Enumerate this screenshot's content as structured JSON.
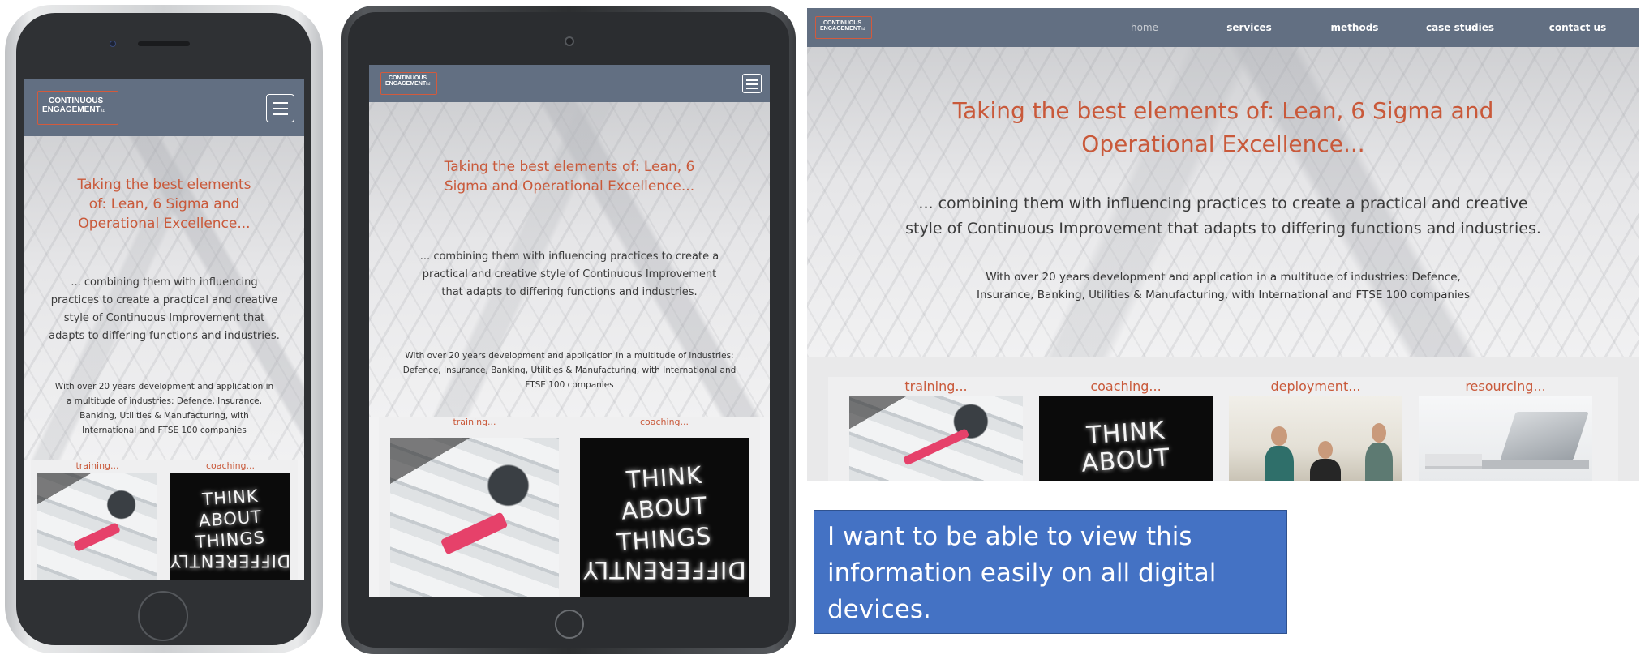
{
  "brand": {
    "line1": "CONTINUOUS",
    "line2": "ENGAGEMENT",
    "suffix": "ltd",
    "accent": "#c9593a",
    "navbar_color": "#626f82"
  },
  "nav": {
    "items": [
      "home",
      "services",
      "methods",
      "case studies",
      "contact us"
    ],
    "active": "home"
  },
  "hero": {
    "title": "Taking the best elements of: Lean, 6 Sigma and Operational Excellence...",
    "subtitle": "... combining them with influencing practices to create a practical and creative style of Continuous Improvement that adapts to differing functions and industries.",
    "detail": "With over 20 years development and application in a multitude of industries: Defence, Insurance, Banking, Utilities & Manufacturing, with International and FTSE 100 companies"
  },
  "cards": [
    {
      "label": "training...",
      "image": "training-desk-photo"
    },
    {
      "label": "coaching...",
      "image": "think-about-things-differently-neon-photo"
    },
    {
      "label": "deployment...",
      "image": "team-meeting-photo"
    },
    {
      "label": "resourcing...",
      "image": "laptop-desk-photo"
    }
  ],
  "neon": {
    "line1": "THINK",
    "line2": "ABOUT",
    "line3": "THINGS",
    "line4": "DIFFERENTLY"
  },
  "note": {
    "text": "I want to be able to view this information easily on all digital devices.",
    "color": "#4472c4"
  },
  "icons": {
    "menu": "hamburger-menu-icon"
  }
}
